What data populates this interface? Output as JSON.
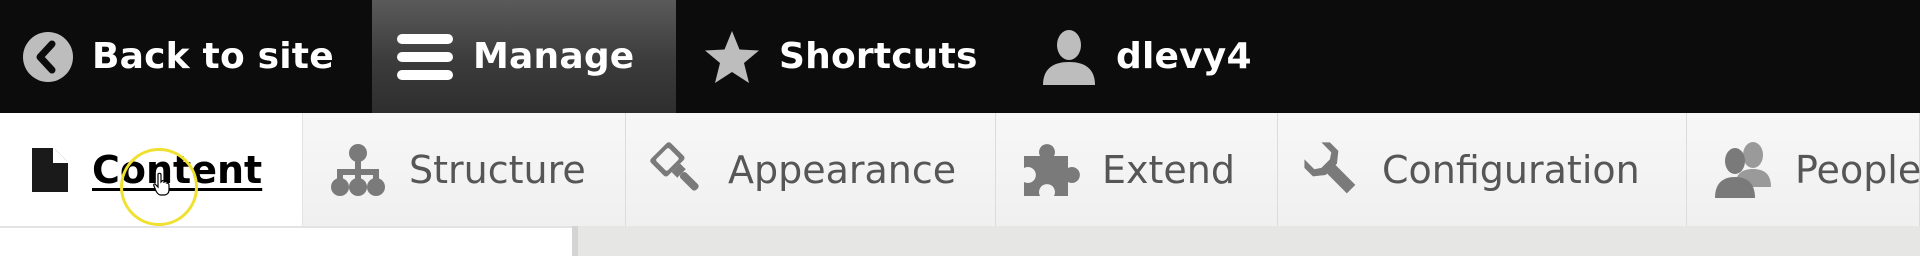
{
  "toolbar": {
    "back_label": "Back to site",
    "manage_label": "Manage",
    "shortcuts_label": "Shortcuts",
    "user_label": "dlevy4",
    "icons": {
      "back": "chevron-left-circle-icon",
      "manage": "hamburger-menu-icon",
      "shortcuts": "star-icon",
      "user": "person-icon"
    }
  },
  "tray": {
    "items": [
      {
        "label": "Content",
        "icon": "document-icon",
        "active": true
      },
      {
        "label": "Structure",
        "icon": "hierarchy-icon",
        "active": false
      },
      {
        "label": "Appearance",
        "icon": "paintbrush-icon",
        "active": false
      },
      {
        "label": "Extend",
        "icon": "puzzle-piece-icon",
        "active": false
      },
      {
        "label": "Configuration",
        "icon": "wrench-icon",
        "active": false
      },
      {
        "label": "People",
        "icon": "people-icon",
        "active": false
      }
    ]
  },
  "colors": {
    "toolbar_bg": "#0c0c0c",
    "manage_active_bg": "#3b3b3b",
    "tray_bg": "#f4f4f4",
    "tray_active_bg": "#ffffff",
    "icon_gray": "#7a7a7a",
    "cursor_highlight": "#f0e030"
  }
}
